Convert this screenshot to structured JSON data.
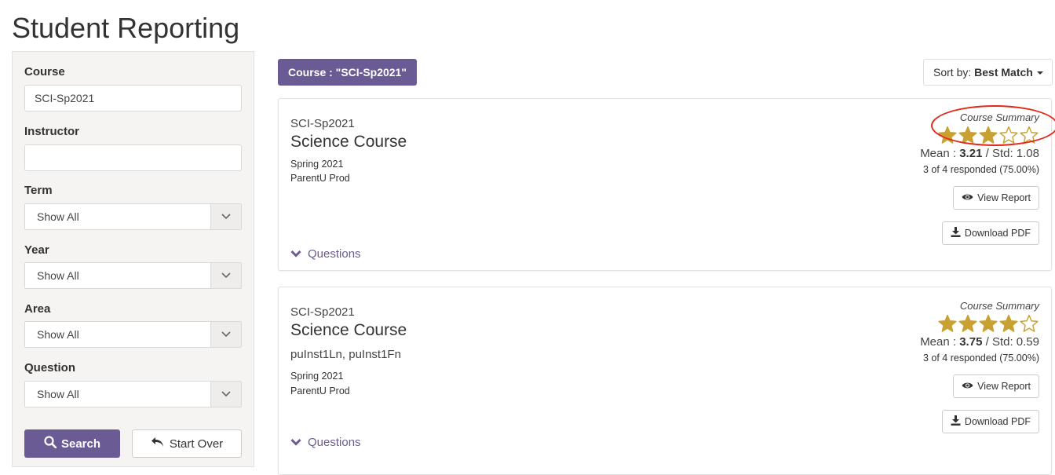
{
  "page": {
    "title": "Student Reporting"
  },
  "sidebar": {
    "course": {
      "label": "Course",
      "value": "SCI-Sp2021"
    },
    "instructor": {
      "label": "Instructor",
      "value": ""
    },
    "term": {
      "label": "Term",
      "selected": "Show All"
    },
    "year": {
      "label": "Year",
      "selected": "Show All"
    },
    "area": {
      "label": "Area",
      "selected": "Show All"
    },
    "question": {
      "label": "Question",
      "selected": "Show All"
    },
    "search_label": "Search",
    "start_over_label": "Start Over"
  },
  "main": {
    "filter_chip": "Course : \"SCI-Sp2021\"",
    "sort": {
      "prefix": "Sort by:",
      "value": "Best Match"
    },
    "cards": [
      {
        "code": "SCI-Sp2021",
        "name": "Science Course",
        "instructors": "",
        "term": "Spring 2021",
        "org": "ParentU Prod",
        "summary_label": "Course Summary",
        "rating": 3.21,
        "mean_label": "Mean :",
        "mean": "3.21",
        "std_label": "Std:",
        "std": "1.08",
        "responded": "3 of 4 responded (75.00%)",
        "view_report": "View Report",
        "download_pdf": "Download PDF",
        "questions_label": "Questions"
      },
      {
        "code": "SCI-Sp2021",
        "name": "Science Course",
        "instructors": "puInst1Ln, puInst1Fn",
        "term": "Spring 2021",
        "org": "ParentU Prod",
        "summary_label": "Course Summary",
        "rating": 3.75,
        "mean_label": "Mean :",
        "mean": "3.75",
        "std_label": "Std:",
        "std": "0.59",
        "responded": "3 of 4 responded (75.00%)",
        "view_report": "View Report",
        "download_pdf": "Download PDF",
        "questions_label": "Questions"
      }
    ]
  },
  "colors": {
    "accent": "#6b5b95",
    "star": "#c9a133",
    "highlight": "#e02a1b"
  },
  "icons": [
    "search-icon",
    "undo-icon",
    "eye-icon",
    "download-icon",
    "chevron-down-icon",
    "star-icon"
  ]
}
